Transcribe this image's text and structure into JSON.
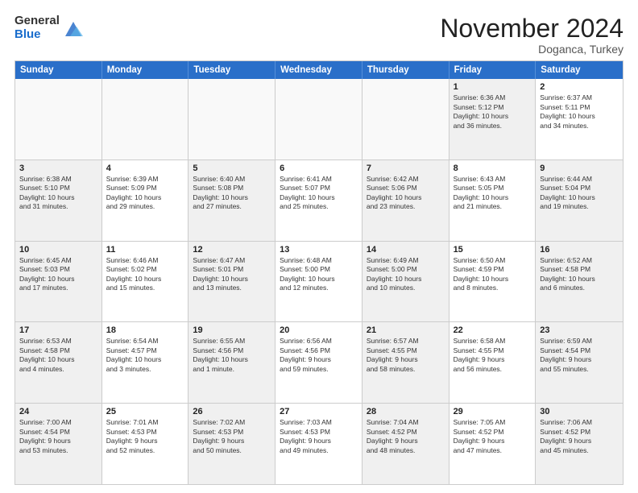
{
  "header": {
    "logo": {
      "line1": "General",
      "line2": "Blue"
    },
    "title": "November 2024",
    "subtitle": "Doganca, Turkey"
  },
  "days_of_week": [
    "Sunday",
    "Monday",
    "Tuesday",
    "Wednesday",
    "Thursday",
    "Friday",
    "Saturday"
  ],
  "weeks": [
    [
      {
        "day": "",
        "info": "",
        "empty": true
      },
      {
        "day": "",
        "info": "",
        "empty": true
      },
      {
        "day": "",
        "info": "",
        "empty": true
      },
      {
        "day": "",
        "info": "",
        "empty": true
      },
      {
        "day": "",
        "info": "",
        "empty": true
      },
      {
        "day": "1",
        "info": "Sunrise: 6:36 AM\nSunset: 5:12 PM\nDaylight: 10 hours\nand 36 minutes.",
        "shaded": true
      },
      {
        "day": "2",
        "info": "Sunrise: 6:37 AM\nSunset: 5:11 PM\nDaylight: 10 hours\nand 34 minutes.",
        "shaded": false
      }
    ],
    [
      {
        "day": "3",
        "info": "Sunrise: 6:38 AM\nSunset: 5:10 PM\nDaylight: 10 hours\nand 31 minutes.",
        "shaded": true
      },
      {
        "day": "4",
        "info": "Sunrise: 6:39 AM\nSunset: 5:09 PM\nDaylight: 10 hours\nand 29 minutes.",
        "shaded": false
      },
      {
        "day": "5",
        "info": "Sunrise: 6:40 AM\nSunset: 5:08 PM\nDaylight: 10 hours\nand 27 minutes.",
        "shaded": true
      },
      {
        "day": "6",
        "info": "Sunrise: 6:41 AM\nSunset: 5:07 PM\nDaylight: 10 hours\nand 25 minutes.",
        "shaded": false
      },
      {
        "day": "7",
        "info": "Sunrise: 6:42 AM\nSunset: 5:06 PM\nDaylight: 10 hours\nand 23 minutes.",
        "shaded": true
      },
      {
        "day": "8",
        "info": "Sunrise: 6:43 AM\nSunset: 5:05 PM\nDaylight: 10 hours\nand 21 minutes.",
        "shaded": false
      },
      {
        "day": "9",
        "info": "Sunrise: 6:44 AM\nSunset: 5:04 PM\nDaylight: 10 hours\nand 19 minutes.",
        "shaded": true
      }
    ],
    [
      {
        "day": "10",
        "info": "Sunrise: 6:45 AM\nSunset: 5:03 PM\nDaylight: 10 hours\nand 17 minutes.",
        "shaded": true
      },
      {
        "day": "11",
        "info": "Sunrise: 6:46 AM\nSunset: 5:02 PM\nDaylight: 10 hours\nand 15 minutes.",
        "shaded": false
      },
      {
        "day": "12",
        "info": "Sunrise: 6:47 AM\nSunset: 5:01 PM\nDaylight: 10 hours\nand 13 minutes.",
        "shaded": true
      },
      {
        "day": "13",
        "info": "Sunrise: 6:48 AM\nSunset: 5:00 PM\nDaylight: 10 hours\nand 12 minutes.",
        "shaded": false
      },
      {
        "day": "14",
        "info": "Sunrise: 6:49 AM\nSunset: 5:00 PM\nDaylight: 10 hours\nand 10 minutes.",
        "shaded": true
      },
      {
        "day": "15",
        "info": "Sunrise: 6:50 AM\nSunset: 4:59 PM\nDaylight: 10 hours\nand 8 minutes.",
        "shaded": false
      },
      {
        "day": "16",
        "info": "Sunrise: 6:52 AM\nSunset: 4:58 PM\nDaylight: 10 hours\nand 6 minutes.",
        "shaded": true
      }
    ],
    [
      {
        "day": "17",
        "info": "Sunrise: 6:53 AM\nSunset: 4:58 PM\nDaylight: 10 hours\nand 4 minutes.",
        "shaded": true
      },
      {
        "day": "18",
        "info": "Sunrise: 6:54 AM\nSunset: 4:57 PM\nDaylight: 10 hours\nand 3 minutes.",
        "shaded": false
      },
      {
        "day": "19",
        "info": "Sunrise: 6:55 AM\nSunset: 4:56 PM\nDaylight: 10 hours\nand 1 minute.",
        "shaded": true
      },
      {
        "day": "20",
        "info": "Sunrise: 6:56 AM\nSunset: 4:56 PM\nDaylight: 9 hours\nand 59 minutes.",
        "shaded": false
      },
      {
        "day": "21",
        "info": "Sunrise: 6:57 AM\nSunset: 4:55 PM\nDaylight: 9 hours\nand 58 minutes.",
        "shaded": true
      },
      {
        "day": "22",
        "info": "Sunrise: 6:58 AM\nSunset: 4:55 PM\nDaylight: 9 hours\nand 56 minutes.",
        "shaded": false
      },
      {
        "day": "23",
        "info": "Sunrise: 6:59 AM\nSunset: 4:54 PM\nDaylight: 9 hours\nand 55 minutes.",
        "shaded": true
      }
    ],
    [
      {
        "day": "24",
        "info": "Sunrise: 7:00 AM\nSunset: 4:54 PM\nDaylight: 9 hours\nand 53 minutes.",
        "shaded": true
      },
      {
        "day": "25",
        "info": "Sunrise: 7:01 AM\nSunset: 4:53 PM\nDaylight: 9 hours\nand 52 minutes.",
        "shaded": false
      },
      {
        "day": "26",
        "info": "Sunrise: 7:02 AM\nSunset: 4:53 PM\nDaylight: 9 hours\nand 50 minutes.",
        "shaded": true
      },
      {
        "day": "27",
        "info": "Sunrise: 7:03 AM\nSunset: 4:53 PM\nDaylight: 9 hours\nand 49 minutes.",
        "shaded": false
      },
      {
        "day": "28",
        "info": "Sunrise: 7:04 AM\nSunset: 4:52 PM\nDaylight: 9 hours\nand 48 minutes.",
        "shaded": true
      },
      {
        "day": "29",
        "info": "Sunrise: 7:05 AM\nSunset: 4:52 PM\nDaylight: 9 hours\nand 47 minutes.",
        "shaded": false
      },
      {
        "day": "30",
        "info": "Sunrise: 7:06 AM\nSunset: 4:52 PM\nDaylight: 9 hours\nand 45 minutes.",
        "shaded": true
      }
    ]
  ]
}
